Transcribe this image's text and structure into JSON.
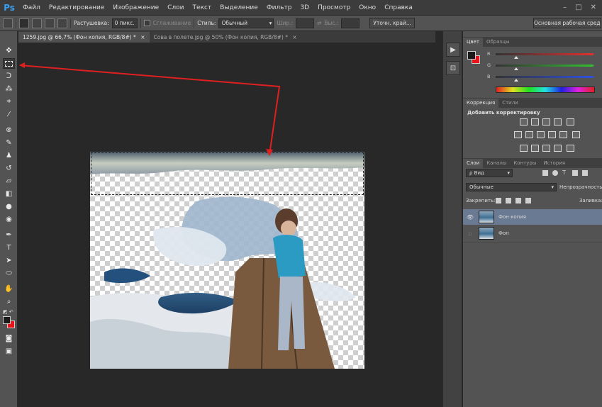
{
  "app": {
    "logo": "Ps",
    "menu": [
      "Файл",
      "Редактирование",
      "Изображение",
      "Слои",
      "Текст",
      "Выделение",
      "Фильтр",
      "3D",
      "Просмотр",
      "Окно",
      "Справка"
    ],
    "window_controls": [
      "–",
      "□",
      "✕"
    ]
  },
  "options_bar": {
    "feather_label": "Растушевка:",
    "feather_value": "0 пикс.",
    "antialias_label": "Сглаживание",
    "style_label": "Стиль:",
    "style_value": "Обычный",
    "width_label": "Шир.:",
    "height_label": "Выс.:",
    "refine_button": "Уточн. край...",
    "workspace_button": "Основная рабочая среда"
  },
  "doc_tabs": [
    {
      "label": "1259.jpg @ 66,7% (Фон копия, RGB/8#) *",
      "close": "×"
    },
    {
      "label": "Сова в полете.jpg @ 50% (Фон копия, RGB/8#) *",
      "close": "×"
    }
  ],
  "panels": {
    "color_tabs": [
      "Цвет",
      "Образцы"
    ],
    "color_sliders": [
      {
        "label": "R",
        "value": 0.2
      },
      {
        "label": "G",
        "value": 0.2
      },
      {
        "label": "B",
        "value": 0.2
      }
    ],
    "adjust_tabs": [
      "Коррекция",
      "Стили"
    ],
    "adjust_heading": "Добавить корректировку",
    "layers_tabs": [
      "Слои",
      "Каналы",
      "Контуры",
      "История"
    ],
    "layers_kind": "ρ Вид",
    "blend_mode": "Обычные",
    "opacity_label": "Непрозрачность:",
    "lock_label": "Закрепить:",
    "fill_label": "Заливка:",
    "layers": [
      {
        "name": "Фон копия",
        "visible": true,
        "selected": true
      },
      {
        "name": "Фон",
        "visible": false,
        "selected": false
      }
    ]
  },
  "colors": {
    "accent": "#3d9eec",
    "foreground": "#1a1a1a",
    "background": "#e8141a",
    "arrow": "#e02020",
    "selected_layer": "#6a7a93"
  },
  "tools": [
    "move-icon",
    "marquee-icon",
    "lasso-icon",
    "magic-wand-icon",
    "crop-icon",
    "eyedropper-icon",
    "healing-icon",
    "brush-icon",
    "stamp-icon",
    "history-brush-icon",
    "eraser-icon",
    "gradient-icon",
    "blur-icon",
    "dodge-icon",
    "pen-icon",
    "type-icon",
    "path-select-icon",
    "shape-icon",
    "hand-icon",
    "zoom-icon"
  ]
}
